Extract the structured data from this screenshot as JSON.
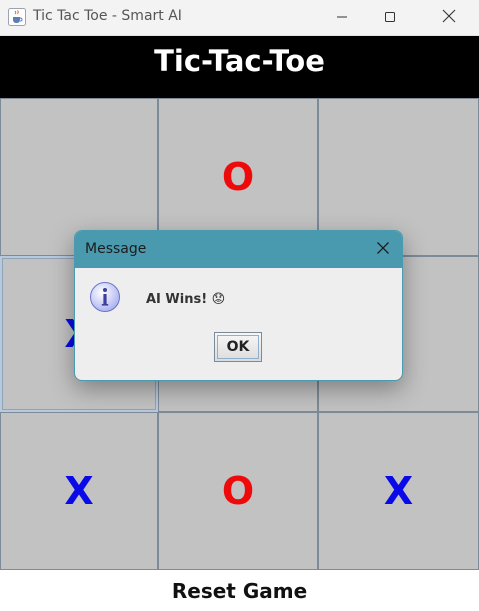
{
  "window": {
    "title": "Tic Tac Toe - Smart AI",
    "icon": "java-cup-icon"
  },
  "header": {
    "title": "Tic-Tac-Toe"
  },
  "board": {
    "cells": [
      "",
      "O",
      "",
      "X",
      "",
      "",
      "X",
      "O",
      "X"
    ]
  },
  "footer": {
    "reset_label": "Reset Game"
  },
  "dialog": {
    "title": "Message",
    "message": "AI Wins! 😟",
    "ok_label": "OK",
    "icon": "info-icon"
  },
  "colors": {
    "X": "#0a0ae8",
    "O": "#ee0a0a",
    "cell_bg": "#c2c2c2",
    "header_bg": "#000000",
    "dialog_title_bg": "#4a9aaf"
  }
}
